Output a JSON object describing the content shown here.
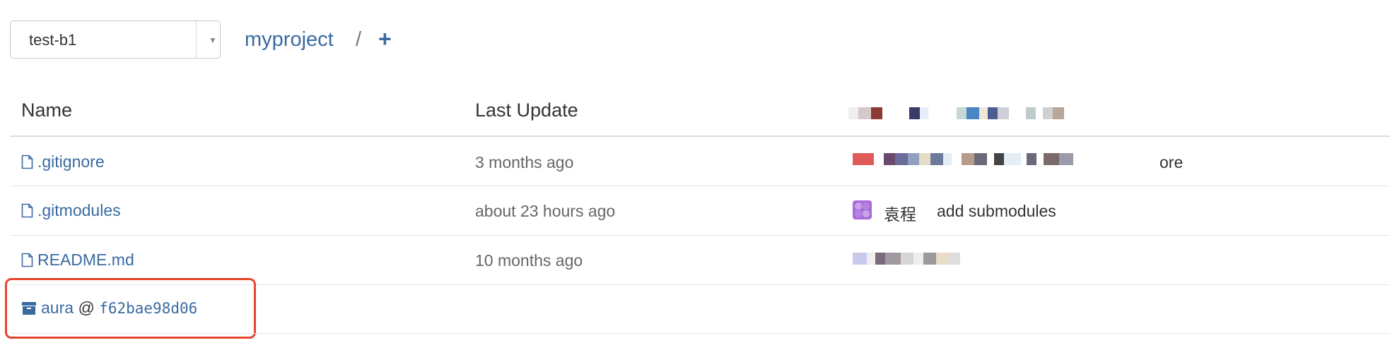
{
  "branch": {
    "selected": "test-b1"
  },
  "breadcrumb": {
    "project": "myproject",
    "separator": "/",
    "add": "+"
  },
  "table": {
    "headers": {
      "name": "Name",
      "last_update": "Last Update"
    },
    "rows": [
      {
        "name": ".gitignore",
        "updated": "3 months ago",
        "commit_suffix": "ore"
      },
      {
        "name": ".gitmodules",
        "updated": "about 23 hours ago",
        "author": "袁程",
        "message": "add submodules"
      },
      {
        "name": "README.md",
        "updated": "10 months ago"
      }
    ],
    "submodule": {
      "name": "aura",
      "at": "@",
      "sha": "f62bae98d06"
    }
  },
  "colors": {
    "link": "#3a6aa0",
    "highlight": "#e8452c"
  },
  "icons": {
    "file": "file-icon",
    "submodule": "archive-icon",
    "dropdown": "chevron-down-icon"
  }
}
